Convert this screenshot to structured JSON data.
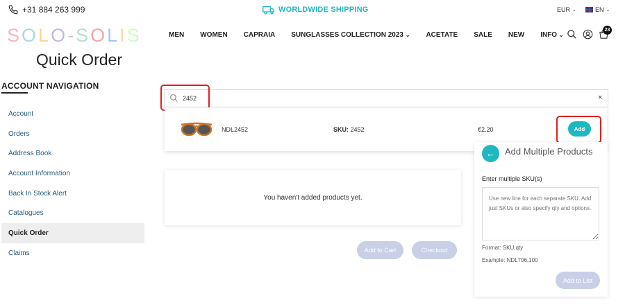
{
  "topbar": {
    "phone": "+31 884 263 999",
    "shipping": "WORLDWIDE SHIPPING",
    "currency": "EUR",
    "language": "EN"
  },
  "logo": {
    "text": "SOLO-SOLIS",
    "letter_colors": [
      "#f4b6c2",
      "#a8dadc",
      "#f7d794",
      "#c9b6e4",
      "#b8e0d2",
      "#f4a6a6",
      "#a0c4ff",
      "#ffd6a5",
      "#caffbf",
      "#f4b6c2"
    ]
  },
  "nav": {
    "items": [
      "MEN",
      "WOMEN",
      "CAPRAIA",
      "SUNGLASSES COLLECTION 2023",
      "ACETATE",
      "SALE",
      "NEW",
      "INFO"
    ],
    "cart_count": "23"
  },
  "page": {
    "title": "Quick Order"
  },
  "sidebar": {
    "heading": "ACCOUNT NAVIGATION",
    "items": [
      {
        "label": "Account"
      },
      {
        "label": "Orders"
      },
      {
        "label": "Address Book"
      },
      {
        "label": "Account Information"
      },
      {
        "label": "Back In Stock Alert"
      },
      {
        "label": "Catalogues"
      },
      {
        "label": "Quick Order"
      },
      {
        "label": "Claims"
      }
    ],
    "active_index": 6
  },
  "search": {
    "value": "2452",
    "clear": "×"
  },
  "result": {
    "name": "NDL2452",
    "sku_label": "SKU:",
    "sku_value": "2452",
    "price": "€2.20",
    "add_label": "Add"
  },
  "cart": {
    "empty_message": "You haven't added products yet.",
    "add_to_cart": "Add to Cart",
    "checkout": "Checkout"
  },
  "multiple": {
    "title": "Add Multiple Products",
    "label": "Enter multiple SKU(s)",
    "placeholder": "Use new line for each separate SKU. Add just SKUs or also specify qty and options.",
    "format": "Format: SKU,qty",
    "example": "Example: NDL706,100",
    "add_to_list": "Add to List"
  },
  "colors": {
    "accent": "#1fb8c0",
    "highlight": "#e02020",
    "disabled_button": "#c9cfe6"
  }
}
